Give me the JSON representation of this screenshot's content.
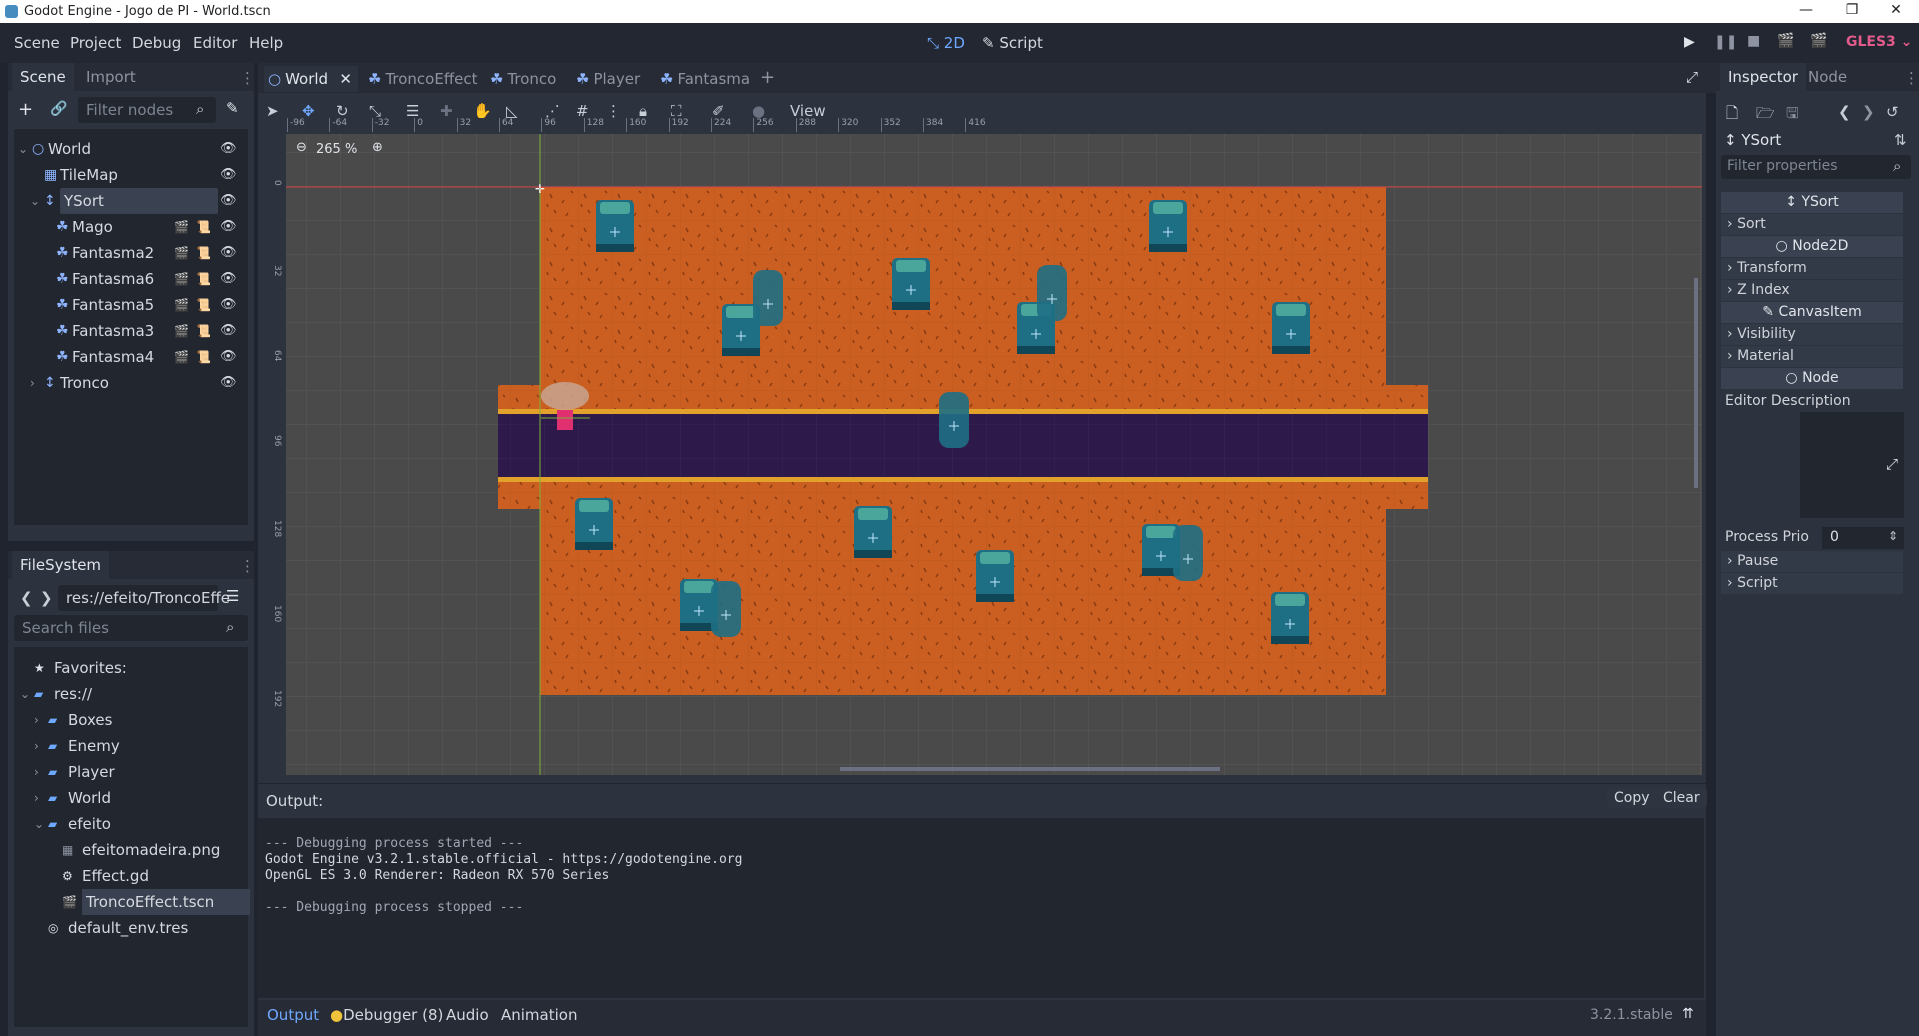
{
  "window": {
    "title": "Godot Engine - Jogo de PI - World.tscn",
    "min": "—",
    "max": "❐",
    "close": "✕"
  },
  "menus": [
    "Scene",
    "Project",
    "Debug",
    "Editor",
    "Help"
  ],
  "workspaces": {
    "mode_2d": "2D",
    "script": "Script"
  },
  "renderer": "GLES3",
  "scene_tabs": [
    "World",
    "TroncoEffect",
    "Tronco",
    "Player",
    "Fantasma"
  ],
  "scene_dock": {
    "tabs": [
      "Scene",
      "Import"
    ],
    "filter_placeholder": "Filter nodes",
    "nodes": [
      {
        "name": "World",
        "level": 0,
        "type": "node2d"
      },
      {
        "name": "TileMap",
        "level": 1,
        "type": "tilemap"
      },
      {
        "name": "YSort",
        "level": 1,
        "type": "ysort",
        "selected": true
      },
      {
        "name": "Mago",
        "level": 2,
        "type": "kinematic",
        "script": true
      },
      {
        "name": "Fantasma2",
        "level": 2,
        "type": "kinematic",
        "script": true
      },
      {
        "name": "Fantasma6",
        "level": 2,
        "type": "kinematic",
        "script": true
      },
      {
        "name": "Fantasma5",
        "level": 2,
        "type": "kinematic",
        "script": true
      },
      {
        "name": "Fantasma3",
        "level": 2,
        "type": "kinematic",
        "script": true
      },
      {
        "name": "Fantasma4",
        "level": 2,
        "type": "kinematic",
        "script": true
      },
      {
        "name": "Tronco",
        "level": 1,
        "type": "ysort"
      }
    ]
  },
  "filesystem": {
    "title": "FileSystem",
    "path": "res://efeito/TroncoEffe",
    "search_placeholder": "Search files",
    "items": [
      {
        "name": "Favorites:",
        "level": 0,
        "kind": "fav"
      },
      {
        "name": "res://",
        "level": 0,
        "kind": "folder"
      },
      {
        "name": "Boxes",
        "level": 1,
        "kind": "folder"
      },
      {
        "name": "Enemy",
        "level": 1,
        "kind": "folder"
      },
      {
        "name": "Player",
        "level": 1,
        "kind": "folder"
      },
      {
        "name": "World",
        "level": 1,
        "kind": "folder"
      },
      {
        "name": "efeito",
        "level": 1,
        "kind": "folder"
      },
      {
        "name": "efeitomadeira.png",
        "level": 2,
        "kind": "image"
      },
      {
        "name": "Effect.gd",
        "level": 2,
        "kind": "script"
      },
      {
        "name": "TroncoEffect.tscn",
        "level": 2,
        "kind": "scene",
        "selected": true
      },
      {
        "name": "default_env.tres",
        "level": 1,
        "kind": "resource"
      }
    ]
  },
  "viewport": {
    "zoom": "265 %",
    "view_menu": "View",
    "ruler_marks": [
      "-96",
      "-64",
      "-32",
      "0",
      "32",
      "64",
      "96",
      "128",
      "160",
      "192",
      "224",
      "256",
      "288",
      "320",
      "352",
      "384",
      "416"
    ],
    "vruler_marks": [
      "0",
      "32",
      "64",
      "96",
      "128",
      "160",
      "192"
    ]
  },
  "output": {
    "label": "Output:",
    "copy": "Copy",
    "clear": "Clear",
    "lines": [
      "--- Debugging process started ---",
      "Godot Engine v3.2.1.stable.official - https://godotengine.org",
      "OpenGL ES 3.0 Renderer: Radeon RX 570 Series",
      "",
      "--- Debugging process stopped ---"
    ]
  },
  "bottom_tabs": [
    "Output",
    "Debugger (8)",
    "Audio",
    "Animation"
  ],
  "version": "3.2.1.stable",
  "inspector": {
    "tabs": [
      "Inspector",
      "Node"
    ],
    "object": "YSort",
    "filter_placeholder": "Filter properties",
    "rows": [
      {
        "kind": "head",
        "label": "YSort"
      },
      {
        "kind": "sec",
        "label": "Sort"
      },
      {
        "kind": "head",
        "label": "Node2D"
      },
      {
        "kind": "sec",
        "label": "Transform"
      },
      {
        "kind": "sec",
        "label": "Z Index"
      },
      {
        "kind": "head",
        "label": "CanvasItem"
      },
      {
        "kind": "sec",
        "label": "Visibility"
      },
      {
        "kind": "sec",
        "label": "Material"
      },
      {
        "kind": "head",
        "label": "Node"
      }
    ],
    "editor_description": "Editor Description",
    "process_priority": {
      "label": "Process Prio",
      "value": "0"
    },
    "after": [
      "Pause",
      "Script"
    ]
  }
}
